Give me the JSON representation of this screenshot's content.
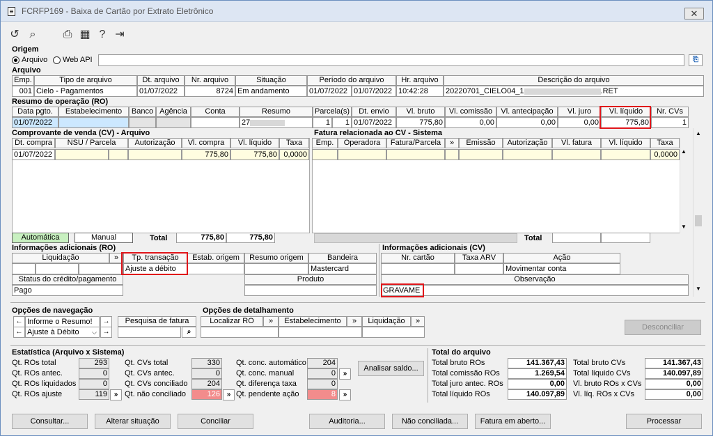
{
  "window": {
    "title": "FCRFP169 - Baixa de Cartão por Extrato Eletrônico",
    "close_glyph": "✕"
  },
  "toolbar": {
    "icons": [
      "undo-icon",
      "search-icon",
      "print-icon",
      "calendar-icon",
      "help-icon",
      "exit-icon"
    ],
    "glyphs": [
      "↺",
      "⌕",
      "⎙",
      "▦",
      "?",
      "⇥"
    ]
  },
  "origem": {
    "label": "Origem",
    "opt_arquivo": "Arquivo",
    "opt_webapi": "Web API"
  },
  "arquivo": {
    "label": "Arquivo",
    "headers": [
      "Emp.",
      "Tipo de arquivo",
      "Dt. arquivo",
      "Nr. arquivo",
      "Situação",
      "Período do arquivo",
      "Hr. arquivo",
      "Descrição do arquivo"
    ],
    "row": {
      "emp": "001",
      "tipo": "Cielo - Pagamentos",
      "dt": "01/07/2022",
      "nr": "8724",
      "situacao": "Em andamento",
      "periodo_ini": "01/07/2022",
      "periodo_fim": "01/07/2022",
      "hr": "10:42:28",
      "desc_a": "20220701_CIELO04_1",
      "desc_b": ".RET"
    }
  },
  "resumo": {
    "label": "Resumo de operação (RO)",
    "headers": [
      "Data pgto.",
      "Estabelecimento",
      "Banco",
      "Agência",
      "Conta",
      "Resumo",
      "Parcela(s)",
      "Dt. envio",
      "Vl. bruto",
      "Vl. comissão",
      "Vl. antecipação",
      "Vl. juro",
      "Vl. líquido",
      "Nr. CVs"
    ],
    "row": {
      "data": "01/07/2022",
      "resumo": "27",
      "parc_a": "1",
      "parc_b": "1",
      "dt_envio": "01/07/2022",
      "bruto": "775,80",
      "comissao": "0,00",
      "antecipacao": "0,00",
      "juro": "0,00",
      "liquido": "775,80",
      "nrcvs": "1"
    }
  },
  "cv": {
    "label": "Comprovante de venda (CV) - Arquivo",
    "headers": [
      "Dt. compra",
      "NSU / Parcela",
      "Autorização",
      "Vl. compra",
      "Vl. líquido",
      "Taxa"
    ],
    "row": {
      "dt": "01/07/2022",
      "compra": "775,80",
      "liquido": "775,80",
      "taxa": "0,0000"
    },
    "btn_auto": "Automática",
    "btn_manual": "Manual",
    "total_label": "Total",
    "total_compra": "775,80",
    "total_liquido": "775,80"
  },
  "fatura": {
    "label": "Fatura relacionada ao CV - Sistema",
    "headers": [
      "Emp.",
      "Operadora",
      "Fatura/Parcela",
      "»",
      "Emissão",
      "Autorização",
      "Vl. fatura",
      "Vl. líquido",
      "Taxa"
    ],
    "row": {
      "taxa": "0,0000"
    },
    "total_label": "Total"
  },
  "info_ro": {
    "label": "Informações adicionais (RO)",
    "headers": [
      "Liquidação",
      "»",
      "Tp. transação",
      "Estab. origem",
      "Resumo origem",
      "Bandeira"
    ],
    "tp_transacao": "Ajuste a débito",
    "bandeira": "Mastercard",
    "status_label": "Status do crédito/pagamento",
    "status": "Pago",
    "produto_label": "Produto"
  },
  "info_cv": {
    "label": "Informações adicionais (CV)",
    "headers": [
      "Nr. cartão",
      "Taxa ARV",
      "Ação"
    ],
    "acao": "Movimentar conta",
    "obs_label": "Observação",
    "obs": "GRAVAME"
  },
  "nav": {
    "label": "Opções de navegação",
    "sel1": "Informe o Resumo!",
    "sel2": "Ajuste à Débito",
    "pesquisa_label": "Pesquisa de fatura"
  },
  "det": {
    "label": "Opções de detalhamento",
    "items": [
      "Localizar RO",
      "»",
      "Estabelecimento",
      "»",
      "Liquidação",
      "»"
    ]
  },
  "desconciliar": "Desconciliar",
  "estat": {
    "label": "Estatística (Arquivo x Sistema)",
    "c1": [
      {
        "l": "Qt. ROs total",
        "v": "293"
      },
      {
        "l": "Qt. ROs antec.",
        "v": "0"
      },
      {
        "l": "Qt. ROs liquidados",
        "v": "0"
      },
      {
        "l": "Qt. ROs ajuste",
        "v": "119"
      }
    ],
    "c2": [
      {
        "l": "Qt. CVs total",
        "v": "330"
      },
      {
        "l": "Qt. CVs antec.",
        "v": "0"
      },
      {
        "l": "Qt. CVs conciliado",
        "v": "204"
      },
      {
        "l": "Qt. não conciliado",
        "v": "126"
      }
    ],
    "c3": [
      {
        "l": "Qt. conc. automático",
        "v": "204"
      },
      {
        "l": "Qt. conc. manual",
        "v": "0"
      },
      {
        "l": "Qt. diferença taxa",
        "v": "0"
      },
      {
        "l": "Qt. pendente ação",
        "v": "8"
      }
    ],
    "analisar": "Analisar saldo..."
  },
  "total_arq": {
    "label": "Total do arquivo",
    "c1": [
      {
        "l": "Total bruto ROs",
        "v": "141.367,43"
      },
      {
        "l": "Total comissão ROs",
        "v": "1.269,54"
      },
      {
        "l": "Total juro antec. ROs",
        "v": "0,00"
      },
      {
        "l": "Total líquido ROs",
        "v": "140.097,89"
      }
    ],
    "c2": [
      {
        "l": "Total bruto CVs",
        "v": "141.367,43"
      },
      {
        "l": "Total líquido CVs",
        "v": "140.097,89"
      },
      {
        "l": "Vl. bruto ROs x CVs",
        "v": "0,00"
      },
      {
        "l": "Vl. líq. ROs x CVs",
        "v": "0,00"
      }
    ]
  },
  "buttons": [
    "Consultar...",
    "Alterar situação",
    "Conciliar",
    "Auditoria...",
    "Não conciliada...",
    "Fatura em aberto...",
    "Processar"
  ]
}
